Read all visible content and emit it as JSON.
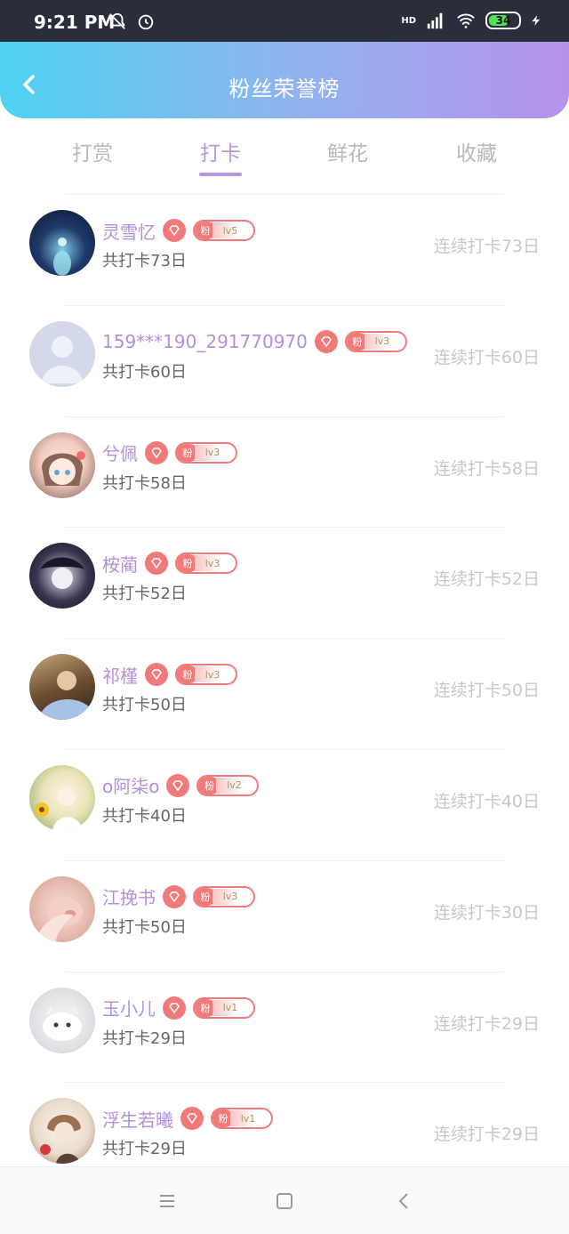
{
  "status_bar": {
    "time": "9:21 PM",
    "network_label": "HD",
    "battery_level": "34",
    "icons": [
      "bell-off-icon",
      "alarm-icon",
      "signal-icon",
      "wifi-icon",
      "battery-icon",
      "charging-icon"
    ]
  },
  "header": {
    "title": "粉丝荣誉榜",
    "back_icon": "chevron-left-icon"
  },
  "tabs": [
    {
      "label": "打赏",
      "active": false
    },
    {
      "label": "打卡",
      "active": true
    },
    {
      "label": "鲜花",
      "active": false
    },
    {
      "label": "收藏",
      "active": false
    }
  ],
  "fan_badge_label": "粉",
  "colors": {
    "accent": "#b897de",
    "name": "#b48ed8",
    "badge": "#f07a7a",
    "header_start": "#4fd3f2",
    "header_end": "#b792ec"
  },
  "users": [
    {
      "name": "灵雪忆",
      "level": "lv5",
      "total": "共打卡73日",
      "streak": "连续打卡73日"
    },
    {
      "name": "159***190_291770970",
      "level": "lv3",
      "total": "共打卡60日",
      "streak": "连续打卡60日"
    },
    {
      "name": "兮佩",
      "level": "lv3",
      "total": "共打卡58日",
      "streak": "连续打卡58日"
    },
    {
      "name": "桉蔺",
      "level": "lv3",
      "total": "共打卡52日",
      "streak": "连续打卡52日"
    },
    {
      "name": "祁槿",
      "level": "lv3",
      "total": "共打卡50日",
      "streak": "连续打卡50日"
    },
    {
      "name": "o阿柒o",
      "level": "lv2",
      "total": "共打卡40日",
      "streak": "连续打卡40日"
    },
    {
      "name": "江挽书",
      "level": "lv3",
      "total": "共打卡50日",
      "streak": "连续打卡30日"
    },
    {
      "name": "玉小儿",
      "level": "lv1",
      "total": "共打卡29日",
      "streak": "连续打卡29日"
    },
    {
      "name": "浮生若曦",
      "level": "lv1",
      "total": "共打卡29日",
      "streak": "连续打卡29日"
    }
  ],
  "nav": {
    "icons": [
      "menu-icon",
      "home-square-icon",
      "back-triangle-icon"
    ]
  }
}
